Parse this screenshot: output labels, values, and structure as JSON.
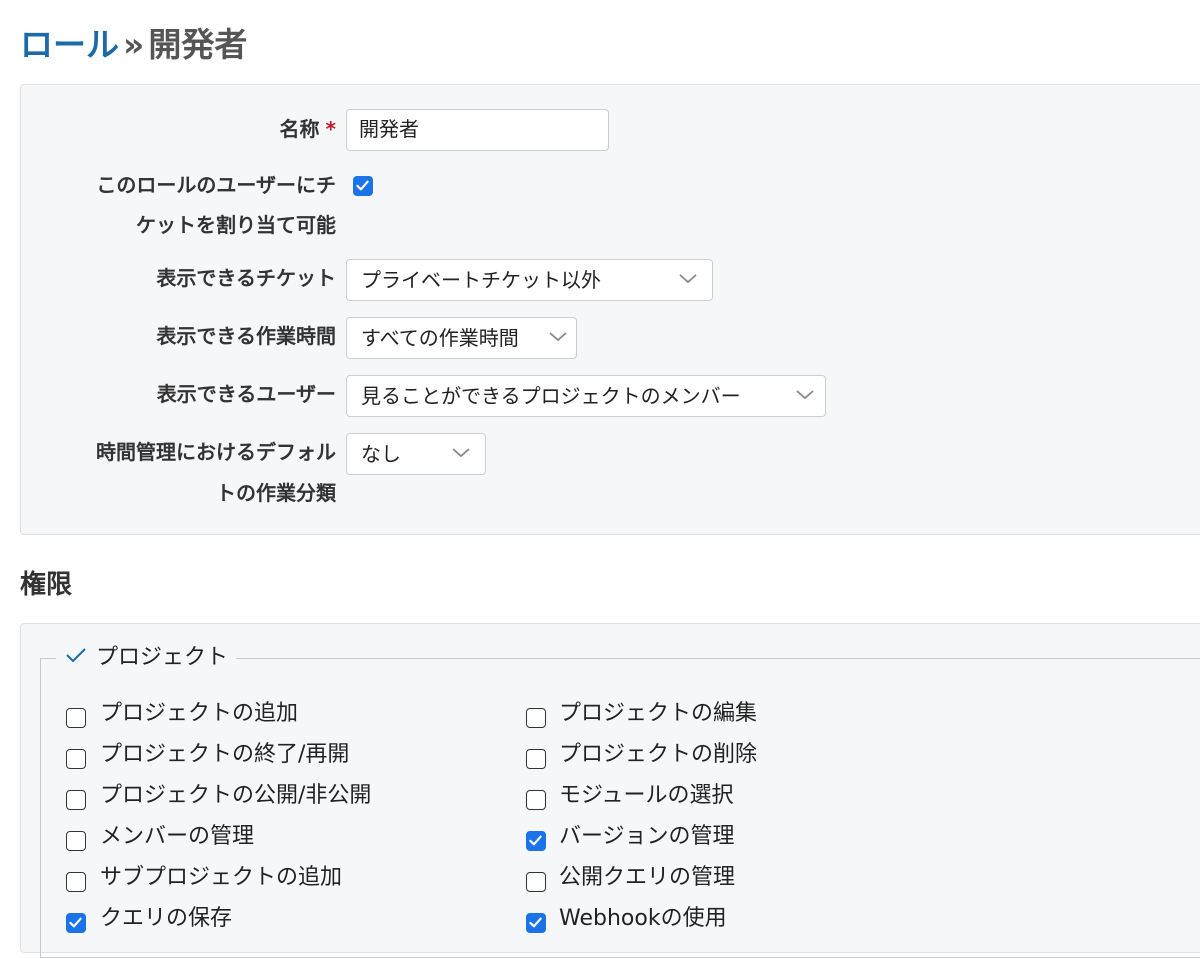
{
  "header": {
    "breadcrumb_link": "ロール",
    "separator": "»",
    "current": "開発者"
  },
  "form": {
    "name_label": "名称",
    "required_mark": "*",
    "name_value": "開発者",
    "assignable_label_line1": "このロールのユーザーにチ",
    "assignable_label_line2": "ケットを割り当て可能",
    "assignable_checked": true,
    "issues_visibility_label": "表示できるチケット",
    "issues_visibility_value": "プライベートチケット以外",
    "time_entries_visibility_label": "表示できる作業時間",
    "time_entries_visibility_value": "すべての作業時間",
    "users_visibility_label": "表示できるユーザー",
    "users_visibility_value": "見ることができるプロジェクトのメンバー",
    "default_activity_label_line1": "時間管理におけるデフォル",
    "default_activity_label_line2": "トの作業分類",
    "default_activity_value": "なし"
  },
  "permissions": {
    "heading": "権限",
    "group_title": "プロジェクト",
    "left": [
      {
        "label": "プロジェクトの追加",
        "checked": false
      },
      {
        "label": "プロジェクトの終了/再開",
        "checked": false
      },
      {
        "label": "プロジェクトの公開/非公開",
        "checked": false
      },
      {
        "label": "メンバーの管理",
        "checked": false
      },
      {
        "label": "サブプロジェクトの追加",
        "checked": false
      },
      {
        "label": "クエリの保存",
        "checked": true
      }
    ],
    "right": [
      {
        "label": "プロジェクトの編集",
        "checked": false
      },
      {
        "label": "プロジェクトの削除",
        "checked": false
      },
      {
        "label": "モジュールの選択",
        "checked": false
      },
      {
        "label": "バージョンの管理",
        "checked": true
      },
      {
        "label": "公開クエリの管理",
        "checked": false
      },
      {
        "label": "Webhookの使用",
        "checked": true
      }
    ]
  },
  "colors": {
    "link": "#1c6aa8",
    "checkbox_on": "#1a73e8",
    "panel_bg": "#f6f7f8",
    "required": "#c0182a"
  }
}
